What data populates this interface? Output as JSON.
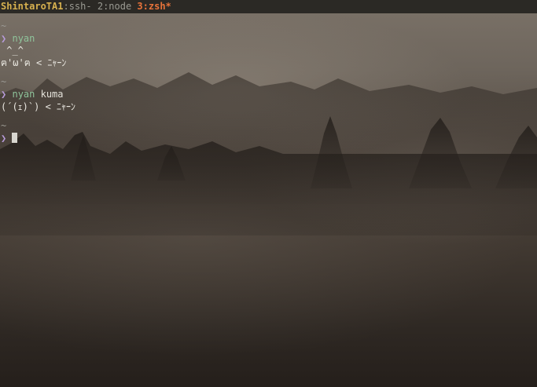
{
  "tmux": {
    "session": "ShintaroTA1",
    "windows": [
      {
        "label": ":ssh- "
      },
      {
        "label": "2:node "
      }
    ],
    "active_window": "3:zsh*"
  },
  "terminal": {
    "tilde": "~",
    "prompt_symbol": "❯",
    "block1": {
      "command": "nyan",
      "output": [
        " ^_^",
        "ฅ'ω'ฅ < ﾆｬｰﾝ"
      ]
    },
    "block2": {
      "command": "nyan",
      "argument": "kuma",
      "output": [
        "(´(ｪ)`) < ﾆｬｰﾝ"
      ]
    }
  },
  "colors": {
    "session": "#d7b14f",
    "active_window": "#e8733a",
    "prompt": "#b79bd9",
    "command": "#8fc49b"
  }
}
